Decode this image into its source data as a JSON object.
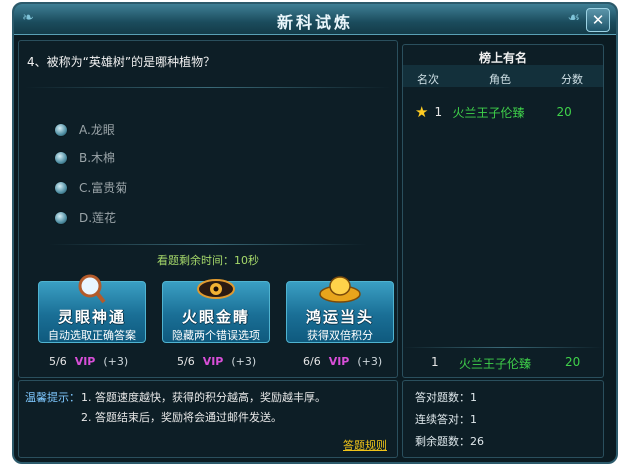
{
  "window": {
    "title": "新科试炼"
  },
  "question": {
    "text": "4、被称为“英雄树”的是哪种植物？"
  },
  "options": [
    {
      "label": "A.龙眼"
    },
    {
      "label": "B.木棉"
    },
    {
      "label": "C.富贵菊"
    },
    {
      "label": "D.莲花"
    }
  ],
  "timer": {
    "text": "看题剩余时间：10秒"
  },
  "powerups": [
    {
      "title": "灵眼神通",
      "desc": "自动选取正确答案",
      "icon": "magnifier-icon",
      "count": "5/6",
      "vip": "VIP",
      "bonus": "(+3)"
    },
    {
      "title": "火眼金睛",
      "desc": "隐藏两个错误选项",
      "icon": "eye-icon",
      "count": "5/6",
      "vip": "VIP",
      "bonus": "(+3)"
    },
    {
      "title": "鸿运当头",
      "desc": "获得双倍积分",
      "icon": "gold-ingot-icon",
      "count": "6/6",
      "vip": "VIP",
      "bonus": "(+3)"
    }
  ],
  "ranking": {
    "header": "榜上有名",
    "columns": {
      "rank": "名次",
      "role": "角色",
      "score": "分数"
    },
    "rows": [
      {
        "rank": "1",
        "name": "火兰王子伦臻",
        "score": "20"
      }
    ],
    "self": {
      "rank": "1",
      "name": "火兰王子伦臻",
      "score": "20"
    }
  },
  "tips": {
    "label": "温馨提示：",
    "line1": "1. 答题速度越快，获得的积分越高，奖励越丰厚。",
    "line2": "2. 答题结束后，奖励将会通过邮件发送。",
    "rules_link": "答题规则"
  },
  "stats": {
    "correct": "答对题数：1",
    "streak": "连续答对：1",
    "remaining": "剩余题数：26"
  },
  "colors": {
    "accent_green": "#3fd14a",
    "vip": "#d84fd8",
    "link": "#f0c419"
  }
}
